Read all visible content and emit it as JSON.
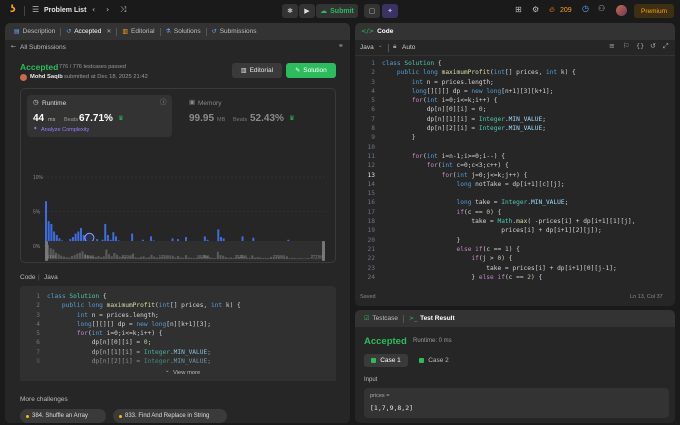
{
  "topbar": {
    "problem_list": "Problem List",
    "submit": "Submit",
    "streak": "209",
    "premium": "Premium"
  },
  "left_tabs": [
    "Description",
    "Accepted",
    "Editorial",
    "Solutions",
    "Submissions"
  ],
  "submission": {
    "back": "All Submissions",
    "status": "Accepted",
    "testcases": "776 / 776 testcases passed",
    "user": "Mohd Saqib",
    "submitted": "submitted at Dec 18, 2025 21:42",
    "editorial_btn": "Editorial",
    "solution_btn": "Solution"
  },
  "runtime": {
    "label": "Runtime",
    "value": "44",
    "unit": "ms",
    "beats_label": "Beats",
    "beats": "67.71%",
    "analyze": "Analyze Complexity"
  },
  "memory": {
    "label": "Memory",
    "value": "99.95",
    "unit": "MB",
    "beats_label": "Beats",
    "beats": "52.43%"
  },
  "chart_data": {
    "type": "bar",
    "y_ticks": [
      "10%",
      "5%",
      "0%"
    ],
    "ylim": [
      0,
      10
    ],
    "x_ticks": [
      "10ms",
      "40ms",
      "70ms",
      "96ms",
      "126ms",
      "160ms",
      "193ms",
      "228ms",
      "277ms"
    ],
    "mini_ticks": [
      "10ms",
      "44ms",
      "87ms",
      "125ms",
      "163ms",
      "201ms",
      "239ms",
      "277ms"
    ],
    "values": [
      6.5,
      3.6,
      3.2,
      2.1,
      1.6,
      1.1,
      0.8,
      0.6,
      0.5,
      1.0,
      1.3,
      1.8,
      2.1,
      2.6,
      1.6,
      1.2,
      0.9,
      0.8,
      0.7,
      1.0,
      0.6,
      0.9,
      3.2,
      1.6,
      0.9,
      2.0,
      1.4,
      0.8,
      0.6,
      0.7,
      0.5,
      0.5,
      1.8,
      0.6,
      0.4,
      0.7,
      0.9,
      0.4,
      0.6,
      1.4,
      0.8,
      0.5,
      0.4,
      0.3,
      0.5,
      0.4,
      0.3,
      1.1,
      0.5,
      1.0,
      0.5,
      0.4,
      1.3,
      0.5,
      0.4,
      0.3,
      0.4,
      0.3,
      0.5,
      1.4,
      0.9,
      0.5,
      0.4,
      0.3,
      2.4,
      1.3,
      1.1,
      0.6,
      0.4,
      0.5,
      0.3,
      0.4,
      0.6,
      1.4,
      0.6,
      0.3,
      0.4,
      1.2,
      0.4,
      0.6,
      0.5,
      0.3,
      0.4,
      0.3,
      0.7,
      0.4,
      0.3,
      0.5,
      0.3,
      0.4,
      0.9,
      0.3,
      0.4,
      0.3,
      0.2,
      0.3,
      0.2,
      0.2,
      0.3,
      0.2,
      0.2,
      0.3,
      0.2,
      0.2
    ],
    "highlight_index": 16
  },
  "code_section": {
    "label": "Code",
    "lang": "Java",
    "lines": [
      [
        [
          "kw",
          "class "
        ],
        [
          "ty",
          "Solution "
        ],
        [
          "pl",
          "{"
        ]
      ],
      [
        [
          "pl",
          "    "
        ],
        [
          "kw",
          "public long "
        ],
        [
          "fn",
          "maximumProfit"
        ],
        [
          "pl",
          "("
        ],
        [
          "kw",
          "int"
        ],
        [
          "pl",
          "[] prices, "
        ],
        [
          "kw",
          "int "
        ],
        [
          "pl",
          "k) {"
        ]
      ],
      [
        [
          "pl",
          "        "
        ],
        [
          "kw",
          "int "
        ],
        [
          "pl",
          "n = prices.length;"
        ]
      ],
      [
        [
          "pl",
          "        "
        ],
        [
          "kw",
          "long"
        ],
        [
          "pl",
          "[][][] dp = "
        ],
        [
          "kw",
          "new long"
        ],
        [
          "pl",
          "[n][k+1][3];"
        ]
      ],
      [
        [
          "pl",
          "        "
        ],
        [
          "cm",
          "for"
        ],
        [
          "pl",
          "("
        ],
        [
          "kw",
          "int "
        ],
        [
          "pl",
          "i=0;i<=k;i++) {"
        ]
      ],
      [
        [
          "pl",
          "            dp[n][0][i] = "
        ],
        [
          "num",
          "0"
        ],
        [
          "pl",
          ";"
        ]
      ],
      [
        [
          "pl",
          "            dp[n][1][i] = "
        ],
        [
          "ty",
          "Integer"
        ],
        [
          "pl",
          "."
        ],
        [
          "var",
          "MIN_VALUE"
        ],
        [
          "pl",
          ";"
        ]
      ],
      [
        [
          "pl",
          "            dp[n][2][i] = "
        ],
        [
          "ty",
          "Integer"
        ],
        [
          "pl",
          "."
        ],
        [
          "var",
          "MIN_VALUE"
        ],
        [
          "pl",
          ";"
        ]
      ]
    ],
    "view_more": "View more"
  },
  "more_challenges": {
    "label": "More challenges",
    "items": [
      "384. Shuffle an Array",
      "833. Find And Replace in String"
    ]
  },
  "editor": {
    "title": "Code",
    "lang": "Java",
    "auto": "Auto",
    "saved": "Saved",
    "cursor": "Ln 13, Col 37",
    "lines": [
      [
        [
          "kw",
          "class "
        ],
        [
          "ty",
          "Solution "
        ],
        [
          "pl",
          "{"
        ]
      ],
      [
        [
          "pl",
          "    "
        ],
        [
          "kw",
          "public long "
        ],
        [
          "fn",
          "maximumProfit"
        ],
        [
          "pl",
          "("
        ],
        [
          "kw",
          "int"
        ],
        [
          "pl",
          "[] prices, "
        ],
        [
          "kw",
          "int "
        ],
        [
          "pl",
          "k) {"
        ]
      ],
      [
        [
          "pl",
          "        "
        ],
        [
          "kw",
          "int "
        ],
        [
          "pl",
          "n = prices.length;"
        ]
      ],
      [
        [
          "pl",
          "        "
        ],
        [
          "kw",
          "long"
        ],
        [
          "pl",
          "[][][] dp = "
        ],
        [
          "kw",
          "new long"
        ],
        [
          "pl",
          "[n+1][3][k+1];"
        ]
      ],
      [
        [
          "pl",
          "        "
        ],
        [
          "cm",
          "for"
        ],
        [
          "pl",
          "("
        ],
        [
          "kw",
          "int "
        ],
        [
          "pl",
          "i=0;i<=k;i++) {"
        ]
      ],
      [
        [
          "pl",
          "            dp[n][0][i] = "
        ],
        [
          "num",
          "0"
        ],
        [
          "pl",
          ";"
        ]
      ],
      [
        [
          "pl",
          "            dp[n][1][i] = "
        ],
        [
          "ty",
          "Integer"
        ],
        [
          "pl",
          "."
        ],
        [
          "var",
          "MIN_VALUE"
        ],
        [
          "pl",
          ";"
        ]
      ],
      [
        [
          "pl",
          "            dp[n][2][i] = "
        ],
        [
          "ty",
          "Integer"
        ],
        [
          "pl",
          "."
        ],
        [
          "var",
          "MIN_VALUE"
        ],
        [
          "pl",
          ";"
        ]
      ],
      [
        [
          "pl",
          "        }"
        ]
      ],
      [
        [
          "pl",
          ""
        ]
      ],
      [
        [
          "pl",
          "        "
        ],
        [
          "cm",
          "for"
        ],
        [
          "pl",
          "("
        ],
        [
          "kw",
          "int "
        ],
        [
          "pl",
          "i=n-1;i>=0;i--) {"
        ]
      ],
      [
        [
          "pl",
          "            "
        ],
        [
          "cm",
          "for"
        ],
        [
          "pl",
          "("
        ],
        [
          "kw",
          "int "
        ],
        [
          "pl",
          "c=0;c<3;c++) {"
        ]
      ],
      [
        [
          "pl",
          "                "
        ],
        [
          "cm",
          "for"
        ],
        [
          "pl",
          "("
        ],
        [
          "kw",
          "int "
        ],
        [
          "pl",
          "j=0;j<=k;j++) {"
        ]
      ],
      [
        [
          "pl",
          "                    "
        ],
        [
          "kw",
          "long "
        ],
        [
          "pl",
          "notTake = dp[i+1][c][j];"
        ]
      ],
      [
        [
          "pl",
          ""
        ]
      ],
      [
        [
          "pl",
          "                    "
        ],
        [
          "kw",
          "long "
        ],
        [
          "pl",
          "take = "
        ],
        [
          "ty",
          "Integer"
        ],
        [
          "pl",
          "."
        ],
        [
          "var",
          "MIN_VALUE"
        ],
        [
          "pl",
          ";"
        ]
      ],
      [
        [
          "pl",
          "                    "
        ],
        [
          "cm",
          "if"
        ],
        [
          "pl",
          "(c == "
        ],
        [
          "num",
          "0"
        ],
        [
          "pl",
          ") {"
        ]
      ],
      [
        [
          "pl",
          "                        take = "
        ],
        [
          "ty",
          "Math"
        ],
        [
          "pl",
          "."
        ],
        [
          "fn",
          "max"
        ],
        [
          "pl",
          "( -prices[i] + dp[i+1][1][j],"
        ]
      ],
      [
        [
          "pl",
          "                                prices[i] + dp[i+1][2][j]);"
        ]
      ],
      [
        [
          "pl",
          "                    }"
        ]
      ],
      [
        [
          "pl",
          "                    "
        ],
        [
          "cm",
          "else if"
        ],
        [
          "pl",
          "(c == "
        ],
        [
          "num",
          "1"
        ],
        [
          "pl",
          ") {"
        ]
      ],
      [
        [
          "pl",
          "                        "
        ],
        [
          "cm",
          "if"
        ],
        [
          "pl",
          "(j > "
        ],
        [
          "num",
          "0"
        ],
        [
          "pl",
          ") {"
        ]
      ],
      [
        [
          "pl",
          "                            take = prices[i] + dp[i+1][0][j-1];"
        ]
      ],
      [
        [
          "pl",
          "                        } "
        ],
        [
          "cm",
          "else if"
        ],
        [
          "pl",
          "(c == "
        ],
        [
          "num",
          "2"
        ],
        [
          "pl",
          ") {"
        ]
      ]
    ]
  },
  "result": {
    "tab_testcase": "Testcase",
    "tab_result": "Test Result",
    "status": "Accepted",
    "runtime": "Runtime: 0 ms",
    "cases": [
      "Case 1",
      "Case 2"
    ],
    "input_label": "Input",
    "param_name": "prices =",
    "param_value": "[1,7,9,8,2]"
  }
}
